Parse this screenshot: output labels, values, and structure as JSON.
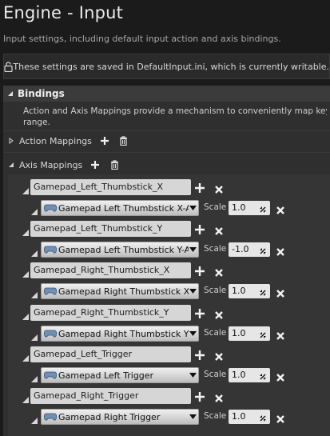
{
  "page": {
    "title": "Engine - Input",
    "subtitle": "Input settings, including default input action and axis bindings."
  },
  "notice": {
    "message": "These settings are saved in DefaultInput.ini, which is currently writable."
  },
  "bindings": {
    "header": "Bindings",
    "description_line1": "Action and Axis Mappings provide a mechanism to conveniently map keys ar",
    "description_line2": "range.",
    "action_mappings_label": "Action Mappings",
    "axis_mappings_label": "Axis Mappings",
    "scale_label": "Scale",
    "axis_mappings": [
      {
        "name": "Gamepad_Left_Thumbstick_X",
        "key": "Gamepad Left Thumbstick X-Axis",
        "scale": "1.0"
      },
      {
        "name": "Gamepad_Left_Thumbstick_Y",
        "key": "Gamepad Left Thumbstick Y-Axis",
        "scale": "-1.0"
      },
      {
        "name": "Gamepad_Right_Thumbstick_X",
        "key": "Gamepad Right Thumbstick X-Axis",
        "scale": "1.0"
      },
      {
        "name": "Gamepad_Right_Thumbstick_Y",
        "key": "Gamepad Right Thumbstick Y-Axis",
        "scale": "1.0"
      },
      {
        "name": "Gamepad_Left_Trigger",
        "key": "Gamepad Left Trigger",
        "scale": "1.0"
      },
      {
        "name": "Gamepad_Right_Trigger",
        "key": "Gamepad Right Trigger",
        "scale": "1.0"
      }
    ]
  },
  "icons": {
    "lock": "lock-icon",
    "add": "plus-icon",
    "delete": "trash-icon",
    "remove": "close-icon",
    "gamepad": "gamepad-icon",
    "dropdown": "chevron-down-icon"
  },
  "colors": {
    "background": "#1b1b1b",
    "panel": "#2f2f2f",
    "section_header": "#3b3b3b",
    "field": "#d6d6d6"
  }
}
